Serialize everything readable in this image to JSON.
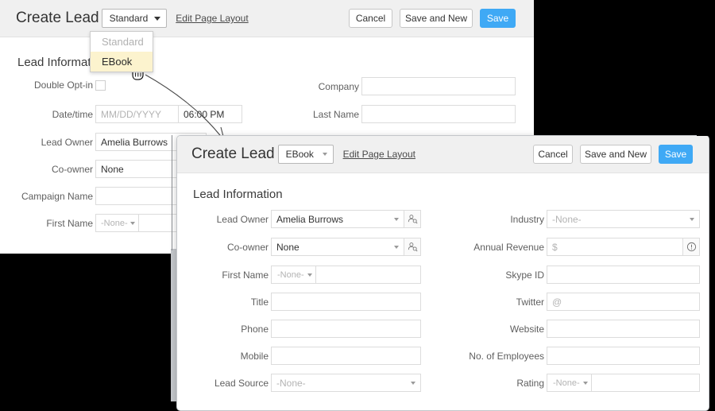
{
  "window_back": {
    "title": "Create Lead",
    "layout_selected": "Standard",
    "edit_link": "Edit Page Layout",
    "buttons": {
      "cancel": "Cancel",
      "save_new": "Save and New",
      "save": "Save"
    },
    "section_title": "Lead Information",
    "dropdown": {
      "options": [
        {
          "label": "Standard",
          "state": "disabled"
        },
        {
          "label": "EBook",
          "state": "active"
        }
      ]
    },
    "left_fields": [
      {
        "label": "Double Opt-in",
        "type": "checkbox",
        "value": ""
      },
      {
        "label": "Date/time",
        "type": "datetime",
        "date_placeholder": "MM/DD/YYYY",
        "time_value": "06:00 PM"
      },
      {
        "label": "Lead Owner",
        "type": "lookup",
        "value": "Amelia Burrows"
      },
      {
        "label": "Co-owner",
        "type": "lookup",
        "value": "None"
      },
      {
        "label": "Campaign Name",
        "type": "text",
        "value": ""
      },
      {
        "label": "First Name",
        "type": "compound",
        "prefix": "-None-",
        "value": ""
      }
    ],
    "right_fields": [
      {
        "label": "Company",
        "type": "text",
        "value": ""
      },
      {
        "label": "Last Name",
        "type": "text",
        "value": ""
      }
    ]
  },
  "window_front": {
    "title": "Create Lead",
    "layout_selected": "EBook",
    "edit_link": "Edit Page Layout",
    "buttons": {
      "cancel": "Cancel",
      "save_new": "Save and New",
      "save": "Save"
    },
    "section_title": "Lead Information",
    "left_fields": [
      {
        "label": "Lead Owner",
        "type": "lookup",
        "value": "Amelia Burrows"
      },
      {
        "label": "Co-owner",
        "type": "lookup",
        "value": "None"
      },
      {
        "label": "First Name",
        "type": "compound",
        "prefix": "-None-",
        "value": ""
      },
      {
        "label": "Title",
        "type": "text",
        "value": ""
      },
      {
        "label": "Phone",
        "type": "text",
        "value": ""
      },
      {
        "label": "Mobile",
        "type": "text",
        "value": ""
      },
      {
        "label": "Lead Source",
        "type": "select",
        "value": "-None-"
      }
    ],
    "right_fields": [
      {
        "label": "Industry",
        "type": "select",
        "value": "-None-"
      },
      {
        "label": "Annual Revenue",
        "type": "currency",
        "placeholder": "$"
      },
      {
        "label": "Skype ID",
        "type": "text",
        "value": ""
      },
      {
        "label": "Twitter",
        "type": "text",
        "placeholder": "@"
      },
      {
        "label": "Website",
        "type": "text",
        "value": ""
      },
      {
        "label": "No. of Employees",
        "type": "text",
        "value": ""
      },
      {
        "label": "Rating",
        "type": "compound",
        "prefix": "-None-",
        "value": ""
      }
    ]
  },
  "icons": {
    "lookup": "user-lookup-icon",
    "info": "info-icon",
    "cursor": "hand-pointer-cursor",
    "annotation": "curved-arrow"
  },
  "colors": {
    "primary": "#3fa9f5",
    "header_bg": "#f0f0f0",
    "highlight": "#fcf3ce",
    "border": "#dcdcdc"
  }
}
